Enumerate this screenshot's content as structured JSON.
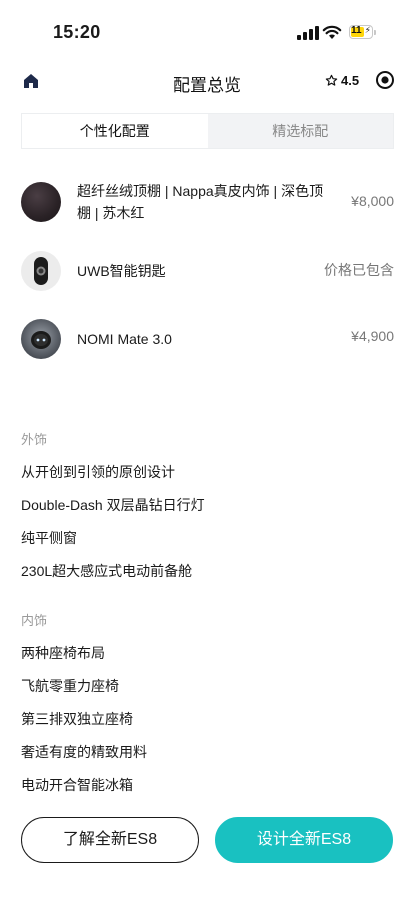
{
  "status_bar": {
    "time": "15:20",
    "battery": "11"
  },
  "header": {
    "title": "配置总览",
    "rating": "4.5"
  },
  "tabs": [
    {
      "label": "个性化配置",
      "active": true
    },
    {
      "label": "精选标配",
      "active": false
    }
  ],
  "config_items": [
    {
      "name": "超纤丝绒顶棚 | Nappa真皮内饰 | 深色顶棚 | 苏木红",
      "price": "¥8,000"
    },
    {
      "name": "UWB智能钥匙",
      "price": "价格已包含"
    },
    {
      "name": "NOMI Mate 3.0",
      "price": "¥4,900"
    }
  ],
  "sections": [
    {
      "title": "外饰",
      "items": [
        "从开创到引领的原创设计",
        "Double-Dash 双层晶钻日行灯",
        "纯平侧窗",
        "230L超大感应式电动前备舱"
      ]
    },
    {
      "title": "内饰",
      "items": [
        "两种座椅布局",
        "飞航零重力座椅",
        "第三排双独立座椅",
        "奢适有度的精致用料",
        "电动开合智能冰箱"
      ]
    }
  ],
  "buttons": {
    "learn": "了解全新ES8",
    "design": "设计全新ES8"
  },
  "colors": {
    "accent": "#19c1c1",
    "text": "#1a1a1a",
    "muted": "#9a9a9a"
  }
}
